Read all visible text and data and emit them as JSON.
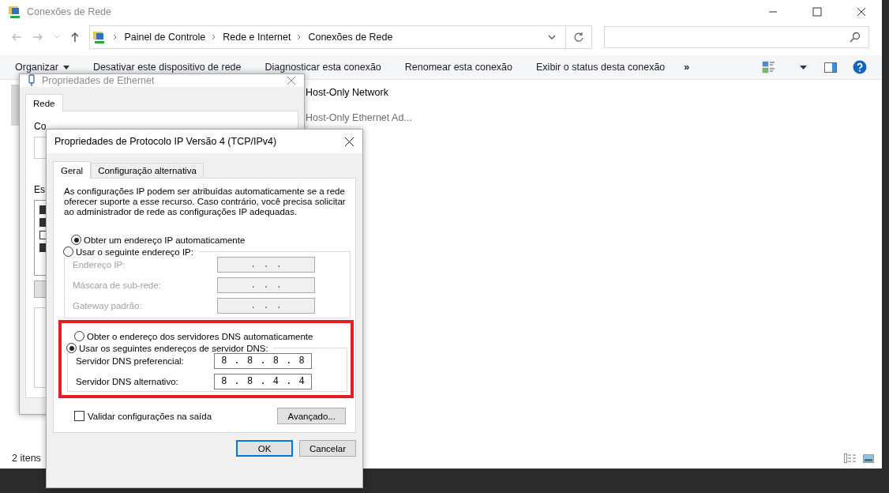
{
  "window": {
    "title": "Conexões de Rede"
  },
  "address_bar": {
    "breadcrumbs": [
      "Painel de Controle",
      "Rede e Internet",
      "Conexões de Rede"
    ]
  },
  "command_bar": {
    "items": [
      "Organizar",
      "Desativar este dispositivo de rede",
      "Diagnosticar esta conexão",
      "Renomear esta conexão",
      "Exibir o status desta conexão"
    ],
    "overflow": "»"
  },
  "connections": [
    {
      "name": "Host-Only Network",
      "detail": "Host-Only Ethernet Ad..."
    }
  ],
  "status_bar": {
    "count": "2 itens"
  },
  "ethernet_dialog": {
    "title": "Propriedades de Ethernet",
    "tabs": [
      {
        "label": "Rede",
        "selected": true
      }
    ],
    "labels": [
      "Co",
      "Es"
    ],
    "components": [
      {
        "checked": true
      },
      {
        "checked": true
      },
      {
        "checked": false
      },
      {
        "checked": true
      }
    ]
  },
  "ipv4_dialog": {
    "title": "Propriedades de Protocolo IP Versão 4 (TCP/IPv4)",
    "tabs": [
      {
        "label": "Geral",
        "selected": true
      },
      {
        "label": "Configuração alternativa",
        "selected": false
      }
    ],
    "intro": "As configurações IP podem ser atribuídas automaticamente se a rede oferecer suporte a esse recurso. Caso contrário, você precisa solicitar ao administrador de rede as configurações IP adequadas.",
    "ip_mode": [
      {
        "label": "Obter um endereço IP automaticamente",
        "selected": true
      },
      {
        "label": "Usar o seguinte endereço IP:",
        "selected": false
      }
    ],
    "ip_fields": [
      {
        "label": "Endereço IP:",
        "value": ". . .",
        "disabled": true
      },
      {
        "label": "Máscara de sub-rede:",
        "value": ". . .",
        "disabled": true
      },
      {
        "label": "Gateway padrão:",
        "value": ". . .",
        "disabled": true
      }
    ],
    "dns_highlighted": true,
    "dns_mode": [
      {
        "label": "Obter o endereço dos servidores DNS automaticamente",
        "selected": false
      },
      {
        "label": "Usar os seguintes endereços de servidor DNS:",
        "selected": true
      }
    ],
    "dns_fields": [
      {
        "label": "Servidor DNS preferencial:",
        "value": "8 . 8 . 8 . 8",
        "disabled": false
      },
      {
        "label": "Servidor DNS alternativo:",
        "value": "8 . 8 . 4 . 4",
        "disabled": false
      }
    ],
    "validate": {
      "label": "Validar configurações na saída",
      "checked": false
    },
    "advanced_button": "Avançado...",
    "buttons": [
      {
        "label": "OK",
        "default": true
      },
      {
        "label": "Cancelar",
        "default": false
      }
    ]
  }
}
